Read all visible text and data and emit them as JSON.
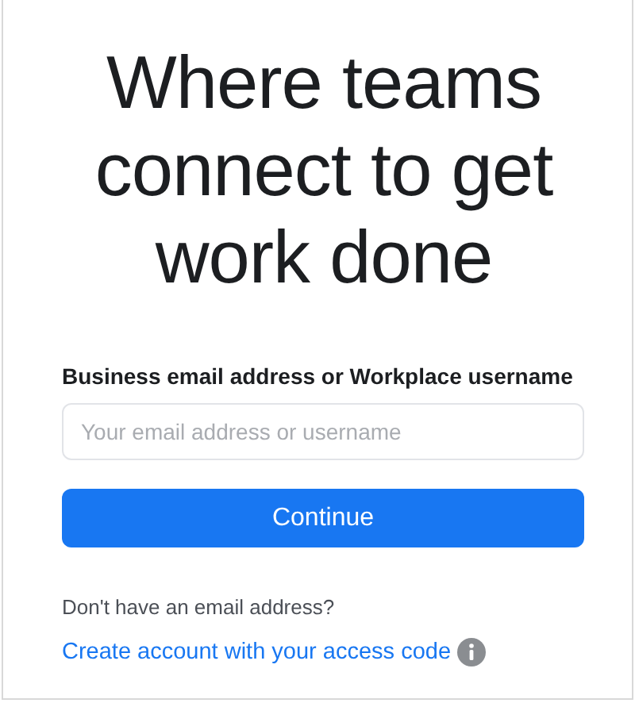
{
  "heading": "Where teams connect to get work done",
  "field": {
    "label": "Business email address or Workplace username",
    "placeholder": "Your email address or username"
  },
  "continue_button": "Continue",
  "prompt": "Don't have an email address?",
  "link": "Create account with your access code"
}
